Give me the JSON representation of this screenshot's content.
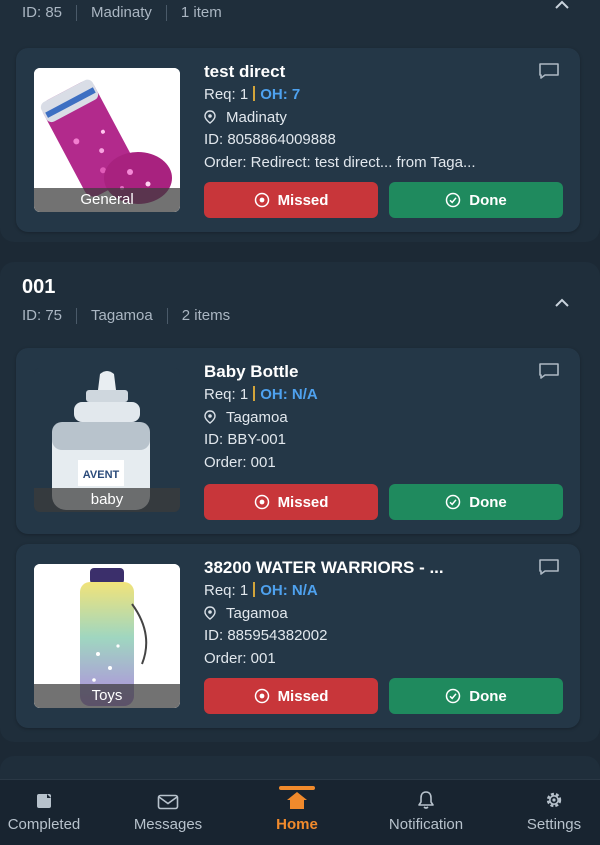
{
  "groups": [
    {
      "title": "",
      "id": "ID: 85",
      "location": "Madinaty",
      "count": "1 item",
      "items": [
        {
          "title": "test direct",
          "req": "Req: 1",
          "oh": "OH: 7",
          "location": "Madinaty",
          "id": "ID: 8058864009888",
          "order": "Order: Redirect: test direct... from Taga...",
          "category": "General",
          "image_icon": "glitter-jar-image"
        }
      ]
    },
    {
      "title": "001",
      "id": "ID: 75",
      "location": "Tagamoa",
      "count": "2 items",
      "items": [
        {
          "title": "Baby Bottle",
          "req": "Req: 1",
          "oh": "OH: N/A",
          "location": "Tagamoa",
          "id": "ID: BBY-001",
          "order": "Order: 001",
          "category": "baby",
          "image_icon": "baby-bottle-image"
        },
        {
          "title": "38200 WATER WARRIORS - ...",
          "req": "Req: 1",
          "oh": "OH: N/A",
          "location": "Tagamoa",
          "id": "ID: 885954382002",
          "order": "Order: 001",
          "category": "Toys",
          "image_icon": "water-bottle-image"
        }
      ]
    }
  ],
  "buttons": {
    "missed": "Missed",
    "done": "Done"
  },
  "nav": [
    {
      "label": "Completed",
      "icon": "completed-icon"
    },
    {
      "label": "Messages",
      "icon": "mail-icon"
    },
    {
      "label": "Home",
      "icon": "home-icon",
      "active": true
    },
    {
      "label": "Notification",
      "icon": "bell-icon"
    },
    {
      "label": "Settings",
      "icon": "gear-icon"
    }
  ],
  "colors": {
    "missed": "#c8363a",
    "done": "#1f8a5e",
    "accent": "#f08a2c",
    "on_hand": "#4ea1ee"
  }
}
